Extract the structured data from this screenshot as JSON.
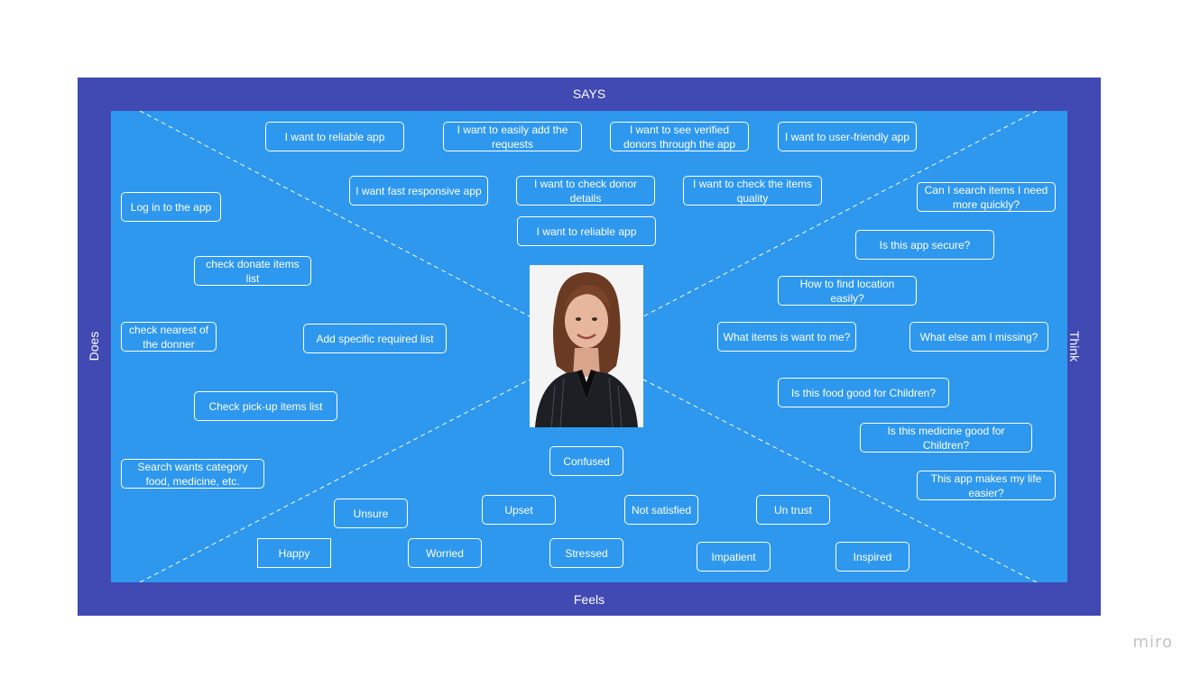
{
  "board": {
    "labels": {
      "says": "SAYS",
      "feels": "Feels",
      "does": "Does",
      "think": "Think"
    },
    "colors": {
      "frame": "#4149b2",
      "canvas": "#2e98ee",
      "text": "#ffffff",
      "watermark": "#c4c4c4"
    },
    "persona_photo": "smiling-woman-portrait"
  },
  "says": [
    "I want to reliable app",
    "I want to easily add the requests",
    "I want to see verified donors through the app",
    "I want to user-friendly app",
    "I want fast responsive app",
    "I want to check donor details",
    "I want to check the items quality",
    "I want to reliable app"
  ],
  "think": [
    "Can I search items I need more quickly?",
    "Is this app secure?",
    "How to find location easily?",
    "What items is want to me?",
    "What  else am I missing?",
    "Is this food good for Children?",
    "Is this medicine good for Children?",
    "This app makes my life easier?"
  ],
  "does": [
    "Log in to the app",
    "check donate items list",
    "check nearest of the donner",
    "Add specific required list",
    "Check pick-up items list",
    "Search wants category food, medicine, etc."
  ],
  "feels": [
    "Confused",
    "Unsure",
    "Upset",
    "Not satisfied",
    "Un trust",
    "Happy",
    "Worried",
    "Stressed",
    "Impatient",
    "Inspired"
  ],
  "watermark": "miro"
}
